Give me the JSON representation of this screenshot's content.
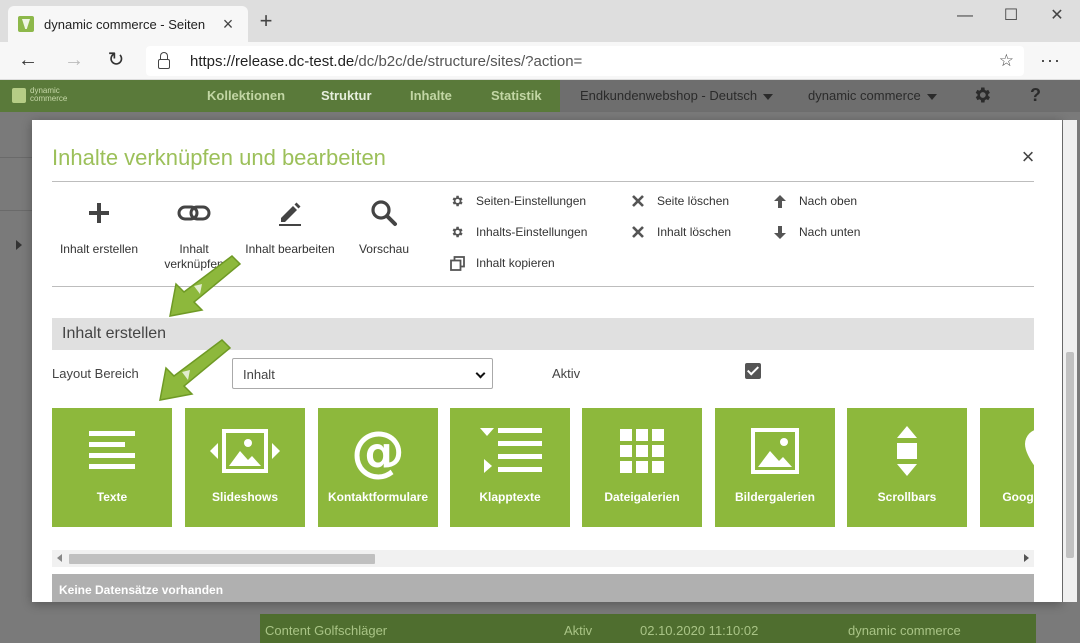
{
  "browser": {
    "tab_title": "dynamic commerce - Seiten",
    "url_host": "https://release.dc-test.de",
    "url_path": "/dc/b2c/de/structure/sites/?action="
  },
  "header": {
    "nav": [
      "Kollektionen",
      "Struktur",
      "Inhalte",
      "Statistik"
    ],
    "active_nav": "Struktur",
    "shop_select": "Endkundenwebshop - Deutsch",
    "company_select": "dynamic commerce",
    "help_label": "?"
  },
  "background_row": {
    "name": "Content Golfschläger",
    "status": "Aktiv",
    "date": "02.10.2020 11:10:02",
    "company": "dynamic commerce"
  },
  "modal": {
    "title": "Inhalte verknüpfen und bearbeiten",
    "close_label": "×",
    "toolbar": {
      "create": "Inhalt erstellen",
      "link": "Inhalt verknüpfen",
      "edit": "Inhalt bearbeiten",
      "preview": "Vorschau"
    },
    "actions": {
      "page_settings": "Seiten-Einstellungen",
      "content_settings": "Inhalts-Einstellungen",
      "copy_content": "Inhalt kopieren",
      "delete_page": "Seite löschen",
      "delete_content": "Inhalt löschen",
      "move_up": "Nach oben",
      "move_down": "Nach unten"
    },
    "section_title": "Inhalt erstellen",
    "layout_label": "Layout Bereich",
    "layout_value": "Inhalt",
    "active_label": "Aktiv",
    "active_checked": true,
    "tiles": [
      "Texte",
      "Slideshows",
      "Kontaktformulare",
      "Klapptexte",
      "Dateigalerien",
      "Bildergalerien",
      "Scrollbars",
      "Google Maps"
    ],
    "empty_message": "Keine Datensätze vorhanden"
  },
  "colors": {
    "accent_green": "#8db83c",
    "title_green": "#9cc05a"
  }
}
